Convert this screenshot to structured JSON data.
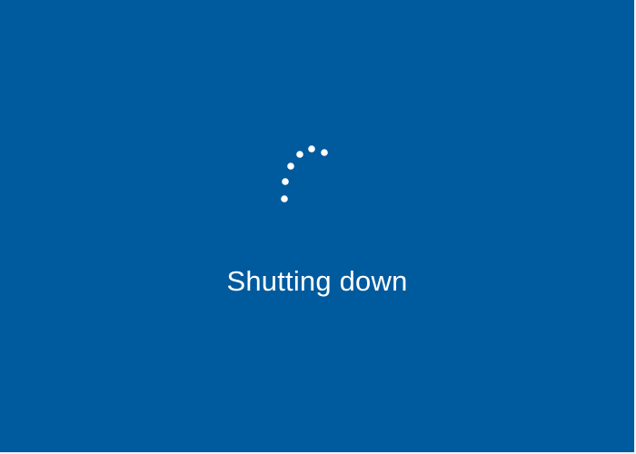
{
  "screen": {
    "status_text": "Shutting down",
    "background_color": "#005a9e",
    "foreground_color": "#ffffff"
  },
  "spinner": {
    "icon": "loading-dots-spinner-icon",
    "dot_count": 6
  }
}
